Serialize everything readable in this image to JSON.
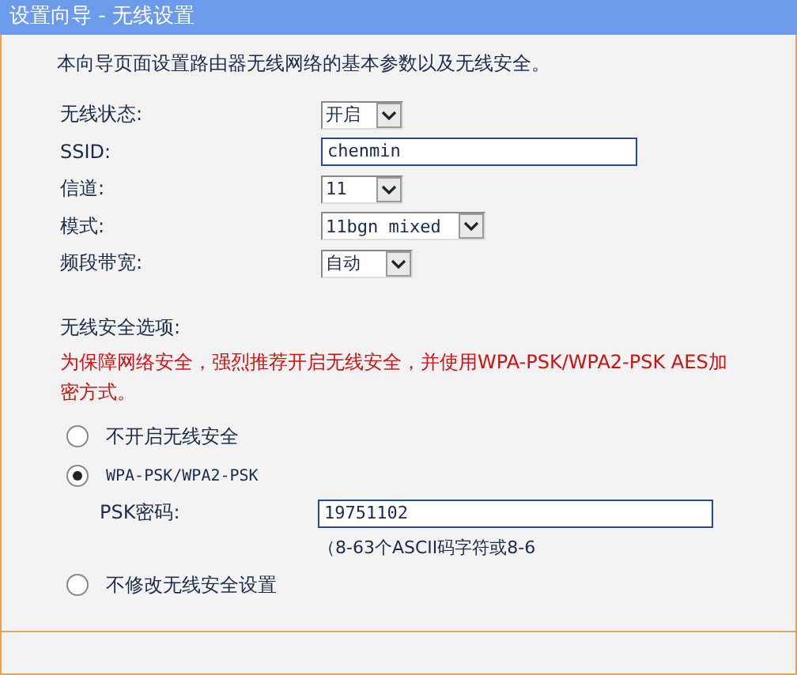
{
  "window": {
    "title": "设置向导 - 无线设置"
  },
  "intro": "本向导页面设置路由器无线网络的基本参数以及无线安全。",
  "settings": [
    {
      "label": "无线状态:",
      "kind": "select",
      "value": "开启"
    },
    {
      "label": "SSID:",
      "kind": "text",
      "value": "chenmin"
    },
    {
      "label": "信道:",
      "kind": "select",
      "value": "11"
    },
    {
      "label": "模式:",
      "kind": "select",
      "value": "11bgn mixed"
    },
    {
      "label": "频段带宽:",
      "kind": "select",
      "value": "自动"
    }
  ],
  "security": {
    "title": "无线安全选项:",
    "warning": "为保障网络安全，强烈推荐开启无线安全，并使用WPA-PSK/WPA2-PSK AES加密方式。",
    "options": [
      {
        "label": "不开启无线安全",
        "selected": false
      },
      {
        "label": "WPA-PSK/WPA2-PSK",
        "selected": true,
        "psk_label": "PSK密码:",
        "psk_value": "19751102",
        "hint": "（8-63个ASCII码字符或8-6"
      },
      {
        "label": "不修改无线安全设置",
        "selected": false
      }
    ]
  }
}
